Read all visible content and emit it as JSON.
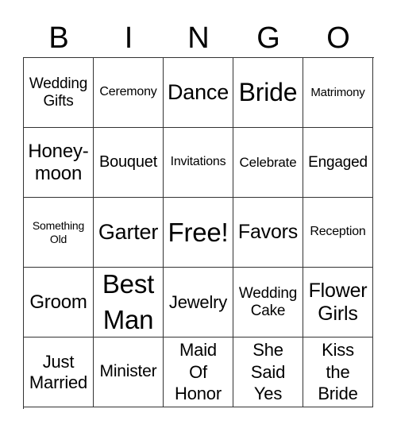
{
  "header": [
    "B",
    "I",
    "N",
    "G",
    "O"
  ],
  "cells": [
    "Wedding\nGifts",
    "Ceremony",
    "Dance",
    "Bride",
    "Matrimony",
    "Honey-\nmoon",
    "Bouquet",
    "Invitations",
    "Celebrate",
    "Engaged",
    "Something\nOld",
    "Garter",
    "Free!",
    "Favors",
    "Reception",
    "Groom",
    "Best\nMan",
    "Jewelry",
    "Wedding\nCake",
    "Flower\nGirls",
    "Just\nMarried",
    "Minister",
    "Maid\nOf\nHonor",
    "She\nSaid\nYes",
    "Kiss\nthe\nBride"
  ]
}
